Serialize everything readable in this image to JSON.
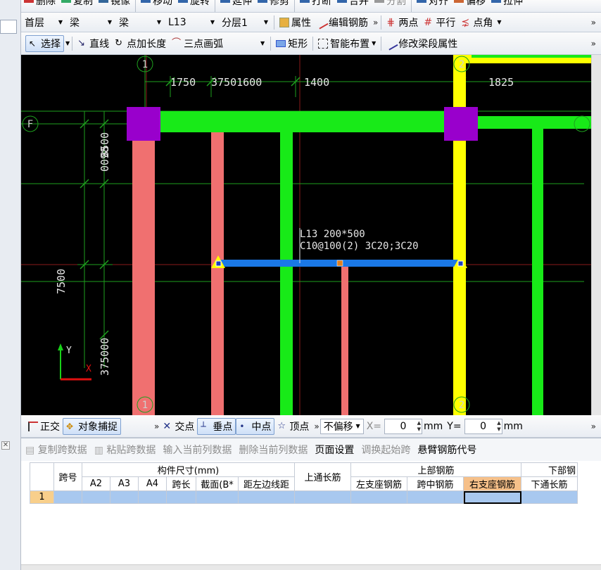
{
  "toolbar_top": {
    "items": [
      "删除",
      "复制",
      "镜像",
      "移动",
      "旋转",
      "延伸",
      "修剪",
      "打断",
      "合并",
      "分割",
      "对齐",
      "偏移",
      "拉伸"
    ]
  },
  "toolbar_props": {
    "floor": "首层",
    "category": "梁",
    "type": "梁",
    "element": "L13",
    "layer": "分层1",
    "properties_label": "属性",
    "edit_rebar_label": "编辑钢筋",
    "two_points": "两点",
    "parallel": "平行",
    "point_angle": "点角"
  },
  "toolbar_draw": {
    "select": "选择",
    "line": "直线",
    "point_length": "点加长度",
    "three_point_arc": "三点画弧",
    "rect": "矩形",
    "smart_layout": "智能布置",
    "modify_span": "修改梁段属性"
  },
  "canvas": {
    "axis_labels": {
      "a1_top": "1",
      "a1_bottom": "1",
      "a2_top": "2",
      "a2_bottom": "2",
      "f_left": "F"
    },
    "dims_top": [
      "1750",
      "37501600",
      "1400",
      "1825"
    ],
    "dims_left": [
      "8500",
      "0098",
      "7500",
      "375000",
      "3750"
    ],
    "beam_label_line1": "L13 200*500",
    "beam_label_line2": "C10@100(2) 3C20;3C20",
    "axis_y": "Y",
    "axis_x": "X"
  },
  "snapbar": {
    "ortho": "正交",
    "object_snap": "对象捕捉",
    "intersection": "交点",
    "perpendicular": "垂点",
    "midpoint": "中点",
    "vertex": "顶点",
    "offset_mode": "不偏移",
    "x_label": "X=",
    "x_value": "0",
    "mm1": "mm",
    "y_label": "Y=",
    "y_value": "0",
    "mm2": "mm"
  },
  "panel": {
    "tools": [
      {
        "label": "复制跨数据",
        "enabled": false
      },
      {
        "label": "粘贴跨数据",
        "enabled": false
      },
      {
        "label": "输入当前列数据",
        "enabled": false
      },
      {
        "label": "删除当前列数据",
        "enabled": false
      },
      {
        "label": "页面设置",
        "enabled": true
      },
      {
        "label": "调换起始跨",
        "enabled": false
      },
      {
        "label": "悬臂钢筋代号",
        "enabled": true
      }
    ],
    "headers": {
      "span_no": "跨号",
      "size_group": "构件尺寸(mm)",
      "a2": "A2",
      "a3": "A3",
      "a4": "A4",
      "span_length": "跨长",
      "section": "截面(B*",
      "edge_dist": "距左边线距",
      "top_through": "上通长筋",
      "top_rebar": "上部钢筋",
      "left_support": "左支座钢筋",
      "mid_span": "跨中钢筋",
      "right_support": "右支座钢筋",
      "bottom_group": "下部钢",
      "bottom_through": "下通长筋"
    },
    "row1": "1"
  }
}
